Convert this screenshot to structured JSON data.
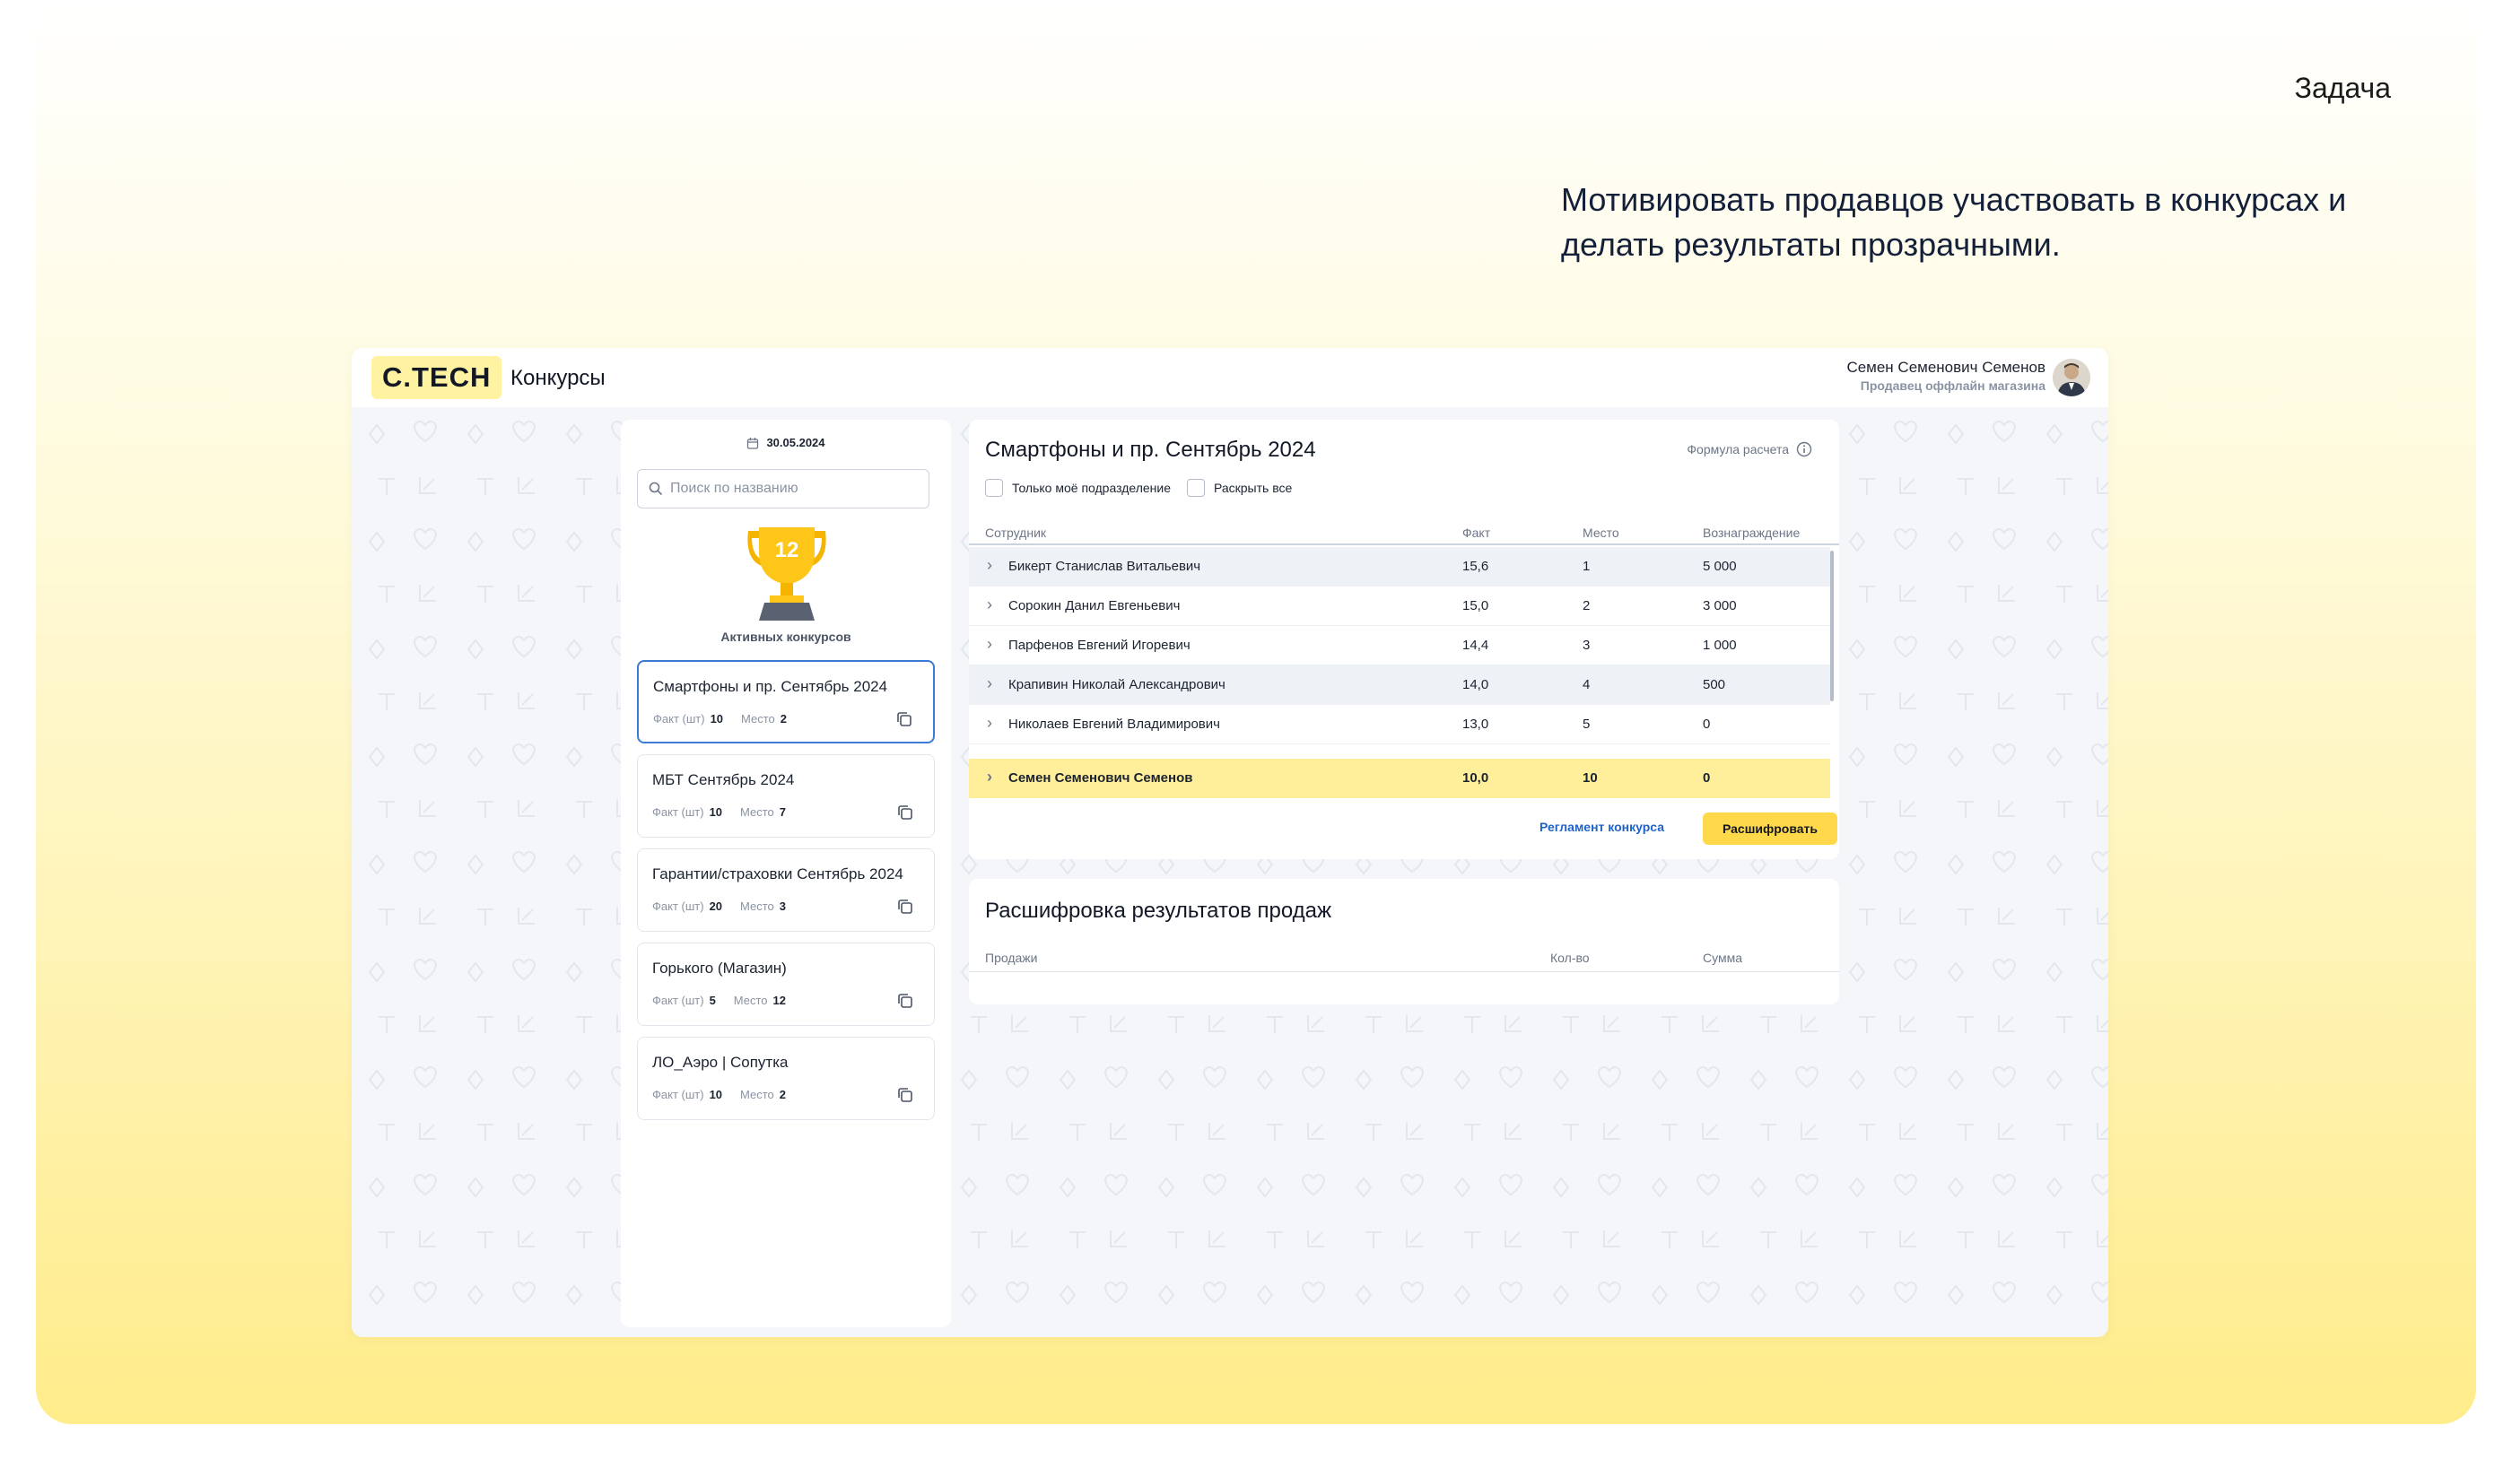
{
  "slide": {
    "label": "Задача",
    "text": "Мотивировать продавцов участвовать в конкурсах и делать результаты прозрачными."
  },
  "topbar": {
    "logo": "С.TECH",
    "section": "Конкурсы",
    "user_name": "Семен Семенович Семенов",
    "user_role": "Продавец оффлайн магазина"
  },
  "sidebar": {
    "date": "30.05.2024",
    "search_placeholder": "Поиск по названию",
    "active_count": "12",
    "active_label": "Активных конкурсов",
    "fact_label": "Факт (шт)",
    "place_label": "Место",
    "contests": [
      {
        "title": "Смартфоны и пр. Сентябрь 2024",
        "fact": "10",
        "place": "2",
        "selected": true
      },
      {
        "title": "МБТ Сентябрь 2024",
        "fact": "10",
        "place": "7"
      },
      {
        "title": "Гарантии/страховки Сентябрь 2024",
        "fact": "20",
        "place": "3"
      },
      {
        "title": "Горького (Магазин)",
        "fact": "5",
        "place": "12"
      },
      {
        "title": "ЛО_Аэро | Сопутка",
        "fact": "10",
        "place": "2"
      }
    ]
  },
  "contest": {
    "title": "Смартфоны и пр. Сентябрь 2024",
    "formula_label": "Формула расчета",
    "filter_own": "Только моё подразделение",
    "filter_expand": "Раскрыть все",
    "columns": {
      "employee": "Сотрудник",
      "fact": "Факт",
      "place": "Место",
      "reward": "Вознаграждение"
    },
    "rows": [
      {
        "name": "Бикерт Станислав Витальевич",
        "fact": "15,6",
        "place": "1",
        "reward": "5 000"
      },
      {
        "name": "Сорокин Данил Евгеньевич",
        "fact": "15,0",
        "place": "2",
        "reward": "3 000"
      },
      {
        "name": "Парфенов Евгений Игоревич",
        "fact": "14,4",
        "place": "3",
        "reward": "1 000"
      },
      {
        "name": "Крапивин Николай Александрович",
        "fact": "14,0",
        "place": "4",
        "reward": "500"
      },
      {
        "name": "Николаев Евгений Владимирович",
        "fact": "13,0",
        "place": "5",
        "reward": "0"
      }
    ],
    "me": {
      "name": "Семен Семенович Семенов",
      "fact": "10,0",
      "place": "10",
      "reward": "0"
    },
    "rules_link": "Регламент конкурса",
    "decode_button": "Расшифровать"
  },
  "sales": {
    "title": "Расшифровка результатов продаж",
    "columns": {
      "sales": "Продажи",
      "qty": "Кол-во",
      "sum": "Сумма"
    }
  },
  "colors": {
    "accent_yellow": "#ffd94a",
    "highlight_row": "#ffef9a",
    "selected_border": "#3a7bd5",
    "link": "#1f63c7"
  }
}
